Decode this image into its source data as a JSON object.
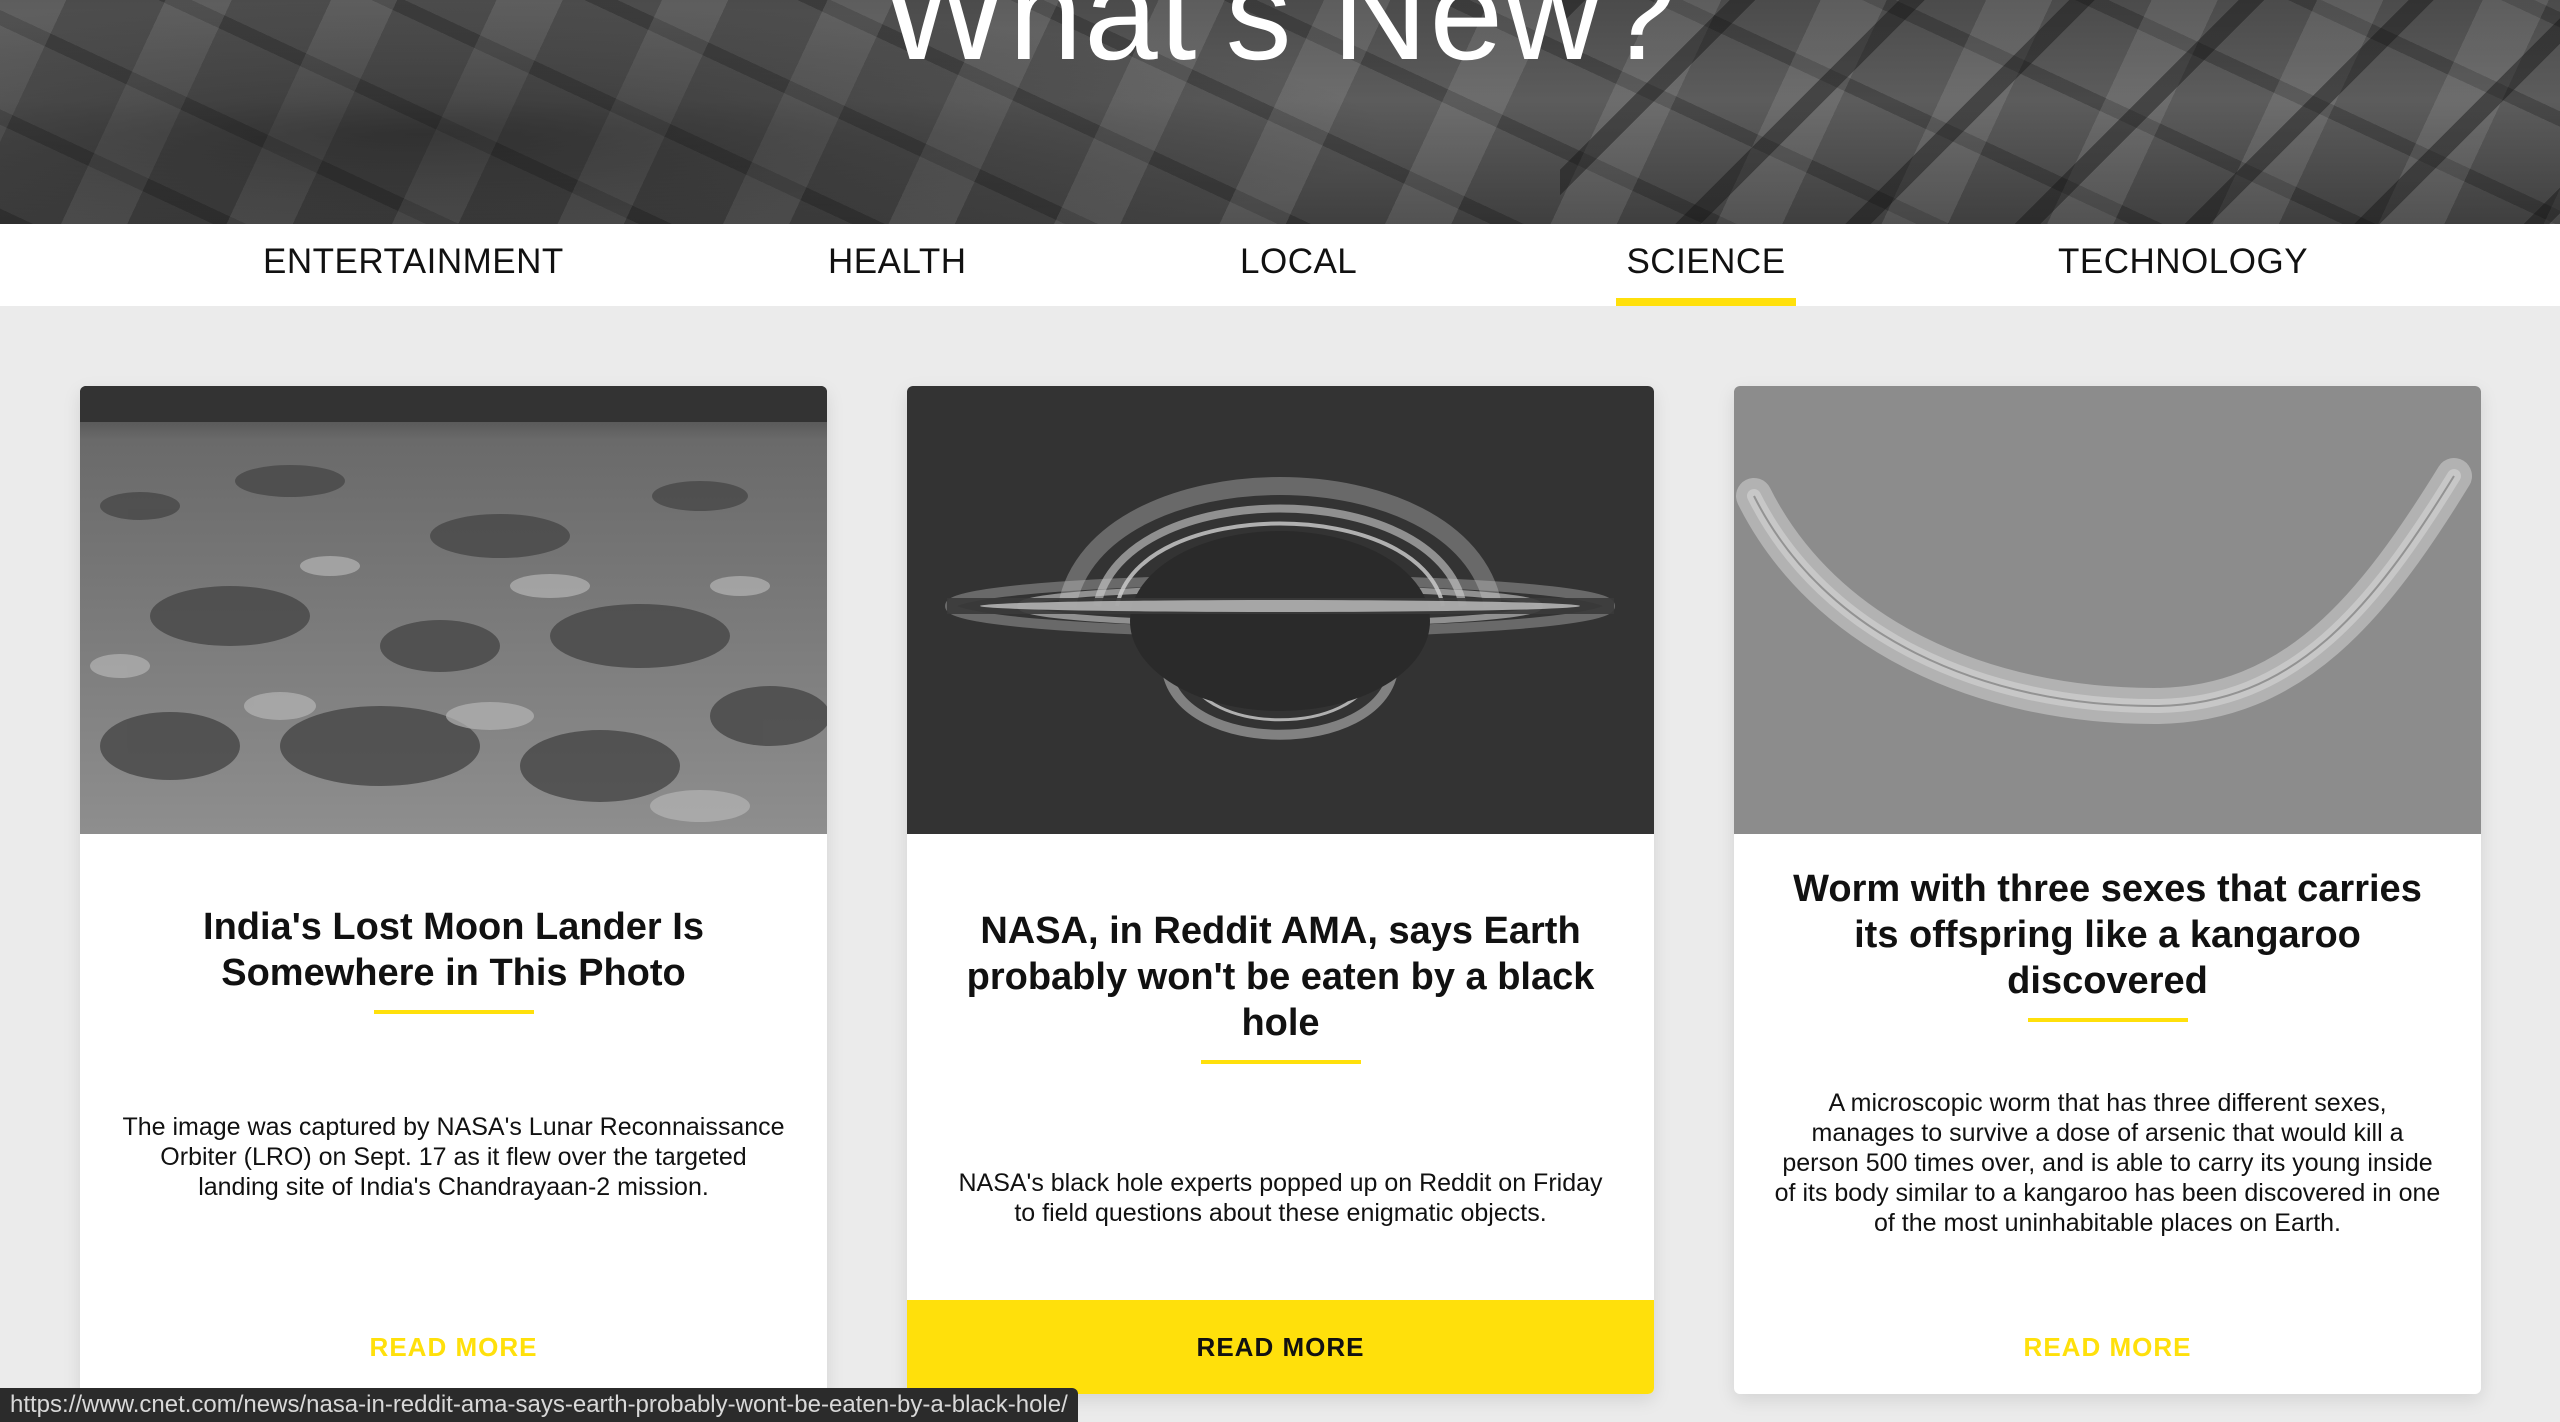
{
  "hero": {
    "title": "What's New?"
  },
  "tabs": [
    {
      "label": "ENTERTAINMENT"
    },
    {
      "label": "HEALTH"
    },
    {
      "label": "LOCAL"
    },
    {
      "label": "SCIENCE",
      "active": true
    },
    {
      "label": "TECHNOLOGY"
    }
  ],
  "cards": [
    {
      "title": "India's Lost Moon Lander Is Somewhere in This Photo",
      "description": "The image was captured by NASA's Lunar Reconnaissance Orbiter (LRO) on Sept. 17 as it flew over the targeted landing site of India's Chandrayaan-2 mission.",
      "read_more": "READ MORE",
      "image": "moon-surface"
    },
    {
      "title": "NASA, in Reddit AMA, says Earth probably won't be eaten by a black hole",
      "description": "NASA's black hole experts popped up on Reddit on Friday to field questions about these enigmatic objects.",
      "read_more": "READ MORE",
      "image": "black-hole"
    },
    {
      "title": "Worm with three sexes that carries its offspring like a kangaroo discovered",
      "description": "A microscopic worm that has three different sexes, manages to survive a dose of arsenic that would kill a person 500 times over, and is able to carry its young inside of its body similar to a kangaroo has been discovered in one of the most uninhabitable places on Earth.",
      "read_more": "READ MORE",
      "image": "worm-microscope"
    }
  ],
  "status_bar": {
    "url": "https://www.cnet.com/news/nasa-in-reddit-ama-says-earth-probably-wont-be-eaten-by-a-black-hole/"
  },
  "colors": {
    "accent": "#ffe00b",
    "page_bg": "#ebebeb",
    "text": "#111111"
  }
}
